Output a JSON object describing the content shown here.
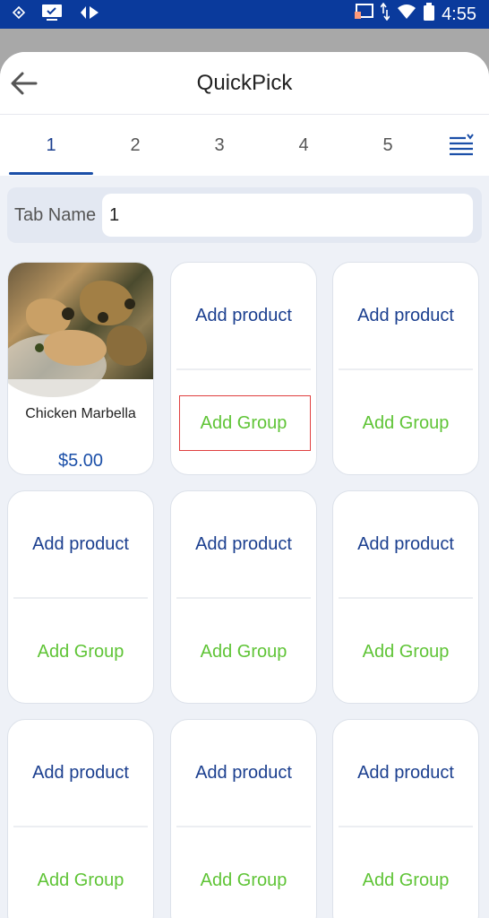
{
  "status_bar": {
    "time": "4:55",
    "icons": [
      "cast-icon",
      "monitor-icon",
      "diamond-arrows-icon",
      "screen-cast-icon",
      "data-arrows-icon",
      "wifi-icon",
      "battery-icon"
    ]
  },
  "header": {
    "title": "QuickPick",
    "back_icon": "arrow-left-icon"
  },
  "tabs": {
    "items": [
      "1",
      "2",
      "3",
      "4",
      "5"
    ],
    "active_index": 0,
    "menu_icon": "menu-sort-icon"
  },
  "tab_name": {
    "label": "Tab Name",
    "value": "1"
  },
  "product_card": {
    "name": "Chicken Marbella",
    "price": "$5.00"
  },
  "empty_card": {
    "add_product_label": "Add product",
    "add_group_label": "Add Group"
  },
  "colors": {
    "status_bar": "#0a3a9c",
    "primary_text": "#1b3f8f",
    "add_group": "#5fc436",
    "price": "#1b4fa8",
    "highlight_border": "#e04040"
  }
}
